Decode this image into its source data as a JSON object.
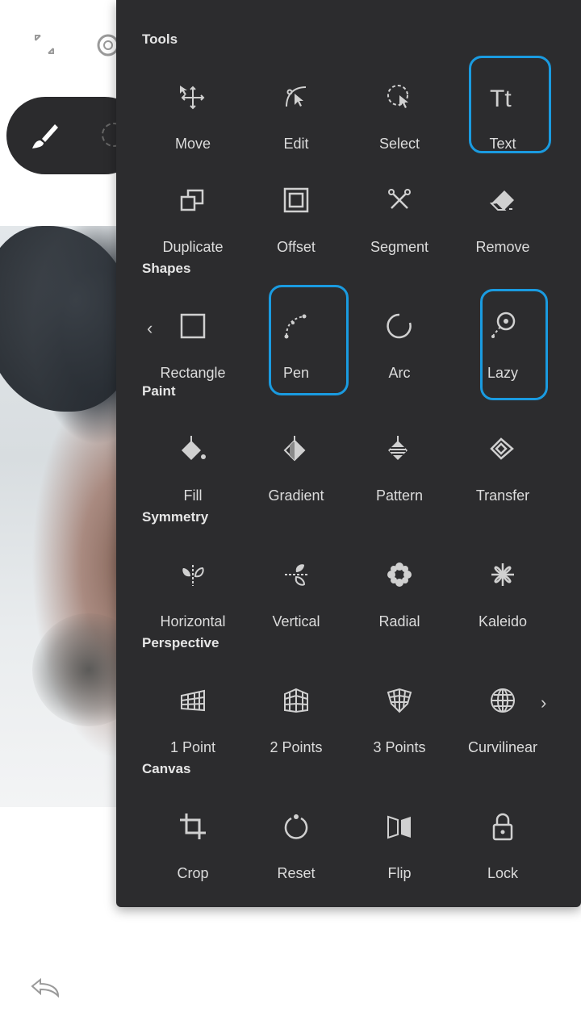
{
  "sections": {
    "tools": "Tools",
    "shapes": "Shapes",
    "paint": "Paint",
    "symmetry": "Symmetry",
    "perspective": "Perspective",
    "canvas": "Canvas"
  },
  "tools": [
    "Move",
    "Edit",
    "Select",
    "Text",
    "Duplicate",
    "Offset",
    "Segment",
    "Remove"
  ],
  "shapes": [
    "Rectangle",
    "Pen",
    "Arc",
    "Lazy"
  ],
  "paint": [
    "Fill",
    "Gradient",
    "Pattern",
    "Transfer"
  ],
  "symmetry": [
    "Horizontal",
    "Vertical",
    "Radial",
    "Kaleido"
  ],
  "perspective": [
    "1 Point",
    "2 Points",
    "3 Points",
    "Curvilinear"
  ],
  "canvas": [
    "Crop",
    "Reset",
    "Flip",
    "Lock"
  ],
  "highlighted": [
    "Text",
    "Pen",
    "Lazy"
  ],
  "colors": {
    "panel": "#2c2c2e",
    "highlight": "#1a9be0",
    "icon": "#d0d0d0"
  },
  "icons": {
    "top": [
      "fullscreen-icon",
      "settings-icon"
    ],
    "brush_pill": [
      "brush-icon",
      "selection-icon"
    ],
    "bottom": [
      "undo-icon"
    ],
    "nav": [
      "chevron-left-icon",
      "chevron-right-icon"
    ]
  },
  "nav": {
    "prev": "‹",
    "next": "›"
  }
}
